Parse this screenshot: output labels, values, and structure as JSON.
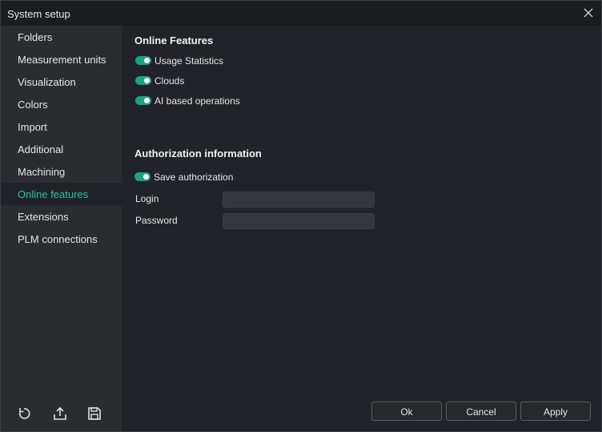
{
  "window": {
    "title": "System setup"
  },
  "sidebar": {
    "items": [
      {
        "label": "Folders"
      },
      {
        "label": "Measurement units"
      },
      {
        "label": "Visualization"
      },
      {
        "label": "Colors"
      },
      {
        "label": "Import"
      },
      {
        "label": "Additional"
      },
      {
        "label": "Machining"
      },
      {
        "label": "Online features",
        "active": true
      },
      {
        "label": "Extensions"
      },
      {
        "label": "PLM connections"
      }
    ],
    "bottom_icons": [
      "reset-icon",
      "export-icon",
      "save-icon"
    ]
  },
  "online_features": {
    "heading": "Online Features",
    "toggles": [
      {
        "label": "Usage Statistics",
        "on": true
      },
      {
        "label": "Clouds",
        "on": true
      },
      {
        "label": "AI based operations",
        "on": true
      }
    ]
  },
  "authorization": {
    "heading": "Authorization information",
    "save_toggle": {
      "label": "Save authorization",
      "on": true
    },
    "login_label": "Login",
    "login_value": "",
    "password_label": "Password",
    "password_value": ""
  },
  "footer": {
    "ok": "Ok",
    "cancel": "Cancel",
    "apply": "Apply"
  },
  "colors": {
    "accent": "#2ec4a2",
    "toggle_on": "#19a37f"
  }
}
